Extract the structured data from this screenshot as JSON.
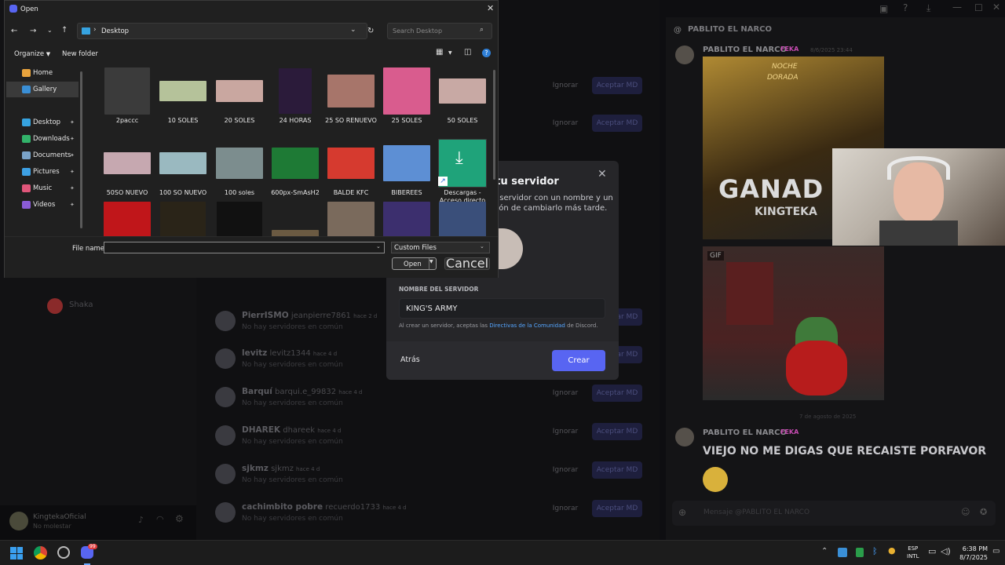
{
  "dialog": {
    "title": "Open",
    "address": "Desktop",
    "search_placeholder": "Search Desktop",
    "toolbar": {
      "organize": "Organize",
      "new_folder": "New folder"
    },
    "nav": [
      {
        "label": "Home",
        "color": "#e8a33d",
        "icon": "home-icon"
      },
      {
        "label": "Gallery",
        "color": "#3a8fd6",
        "icon": "gallery-icon"
      },
      {
        "label": "Desktop",
        "color": "#36a3e0",
        "icon": "desktop-icon"
      },
      {
        "label": "Downloads",
        "color": "#32b36a",
        "icon": "download-icon"
      },
      {
        "label": "Documents",
        "color": "#7aa3c8",
        "icon": "documents-icon"
      },
      {
        "label": "Pictures",
        "color": "#3da0e4",
        "icon": "pictures-icon"
      },
      {
        "label": "Music",
        "color": "#e0567a",
        "icon": "music-icon"
      },
      {
        "label": "Videos",
        "color": "#8a5bd6",
        "icon": "videos-icon"
      }
    ],
    "files": [
      {
        "name": "2paccc",
        "color": "#3b3b3b"
      },
      {
        "name": "10 SOLES",
        "color": "#b5c29a"
      },
      {
        "name": "20 SOLES",
        "color": "#c9a7a0"
      },
      {
        "name": "24 HORAS",
        "color": "#2b1b3a"
      },
      {
        "name": "25 SO RENUEVO",
        "color": "#a7756a"
      },
      {
        "name": "25 SOLES",
        "color": "#d95c8e"
      },
      {
        "name": "50 SOLES",
        "color": "#c8a9a4"
      },
      {
        "name": "50SO NUEVO",
        "color": "#c6a8b0"
      },
      {
        "name": "100 SO NUEVO",
        "color": "#9ab9c0"
      },
      {
        "name": "100 soles",
        "color": "#7c8d8e"
      },
      {
        "name": "600px-SmAsH2",
        "color": "#1e7a35"
      },
      {
        "name": "BALDE KFC",
        "color": "#d63a2f"
      },
      {
        "name": "BIBEREES",
        "color": "#5d8fd4"
      },
      {
        "name": "Descargas - Acceso directo",
        "color": "#1fa37a"
      },
      {
        "name": "",
        "color": "#c0161a"
      },
      {
        "name": "",
        "color": "#2a2418"
      },
      {
        "name": "",
        "color": "#111111"
      },
      {
        "name": "",
        "color": "#6b5a42"
      },
      {
        "name": "",
        "color": "#7a6a5c"
      },
      {
        "name": "",
        "color": "#3c2f6e"
      },
      {
        "name": "",
        "color": "#3a4f7a"
      }
    ],
    "file_name_label": "File name:",
    "file_name_value": "",
    "filter": "Custom Files",
    "open_label": "Open",
    "cancel_label": "Cancel"
  },
  "modal": {
    "title_fragment": "a tu servidor",
    "desc_line1": "o servidor con un nombre y un",
    "desc_line2": "ción de cambiarlo más tarde.",
    "server_name_label": "NOMBRE DEL SERVIDOR",
    "server_name_value": "KING'S ARMY",
    "terms_prefix": "Al crear un servidor, aceptas las ",
    "terms_link": "Directivas de la Comunidad",
    "terms_suffix": " de Discord.",
    "back_label": "Atrás",
    "create_label": "Crear"
  },
  "discord": {
    "left_items": [
      {
        "name": "Shaka"
      }
    ],
    "requests": [
      {
        "name": "PierrISMO",
        "user": "jeanpierre7861",
        "time": "hace 2 d",
        "sub": "No hay servidores en común"
      },
      {
        "name": "levitz",
        "user": "levitz1344",
        "time": "hace 4 d",
        "sub": "No hay servidores en común"
      },
      {
        "name": "Barquí",
        "user": "barqui.e_99832",
        "time": "hace 4 d",
        "sub": "No hay servidores en común"
      },
      {
        "name": "DHAREK",
        "user": "dhareek",
        "time": "hace 4 d",
        "sub": "No hay servidores en común"
      },
      {
        "name": "sjkmz",
        "user": "sjkmz",
        "time": "hace 4 d",
        "sub": "No hay servidores en común"
      },
      {
        "name": "cachimbito pobre",
        "user": "recuerdo1733",
        "time": "hace 4 d",
        "sub": "No hay servidores en común"
      }
    ],
    "ignore_label": "Ignorar",
    "accept_label": "Aceptar MD",
    "user_name": "KingtekaOficial",
    "user_status": "No molestar",
    "dm": {
      "header": "PABLITO EL NARCO",
      "author": "PABLITO EL NARCO",
      "tag": "FEKA",
      "time1": "8/6/2025 23:44",
      "gif_label": "GIF",
      "date_divider": "7 de agosto de 2025",
      "message": "VIEJO NO ME DIGAS QUE RECAISTE PORFAVOR",
      "input_placeholder": "Mensaje @PABLITO EL NARCO",
      "stream_texts": {
        "t1": "GANAD",
        "t2": "KINGTEKA",
        "t3": "NOCHE",
        "t4": "DORADA"
      }
    }
  },
  "taskbar": {
    "lang1": "ESP",
    "lang2": "INTL",
    "time": "6:38 PM",
    "date": "8/7/2025",
    "badge": "99"
  }
}
